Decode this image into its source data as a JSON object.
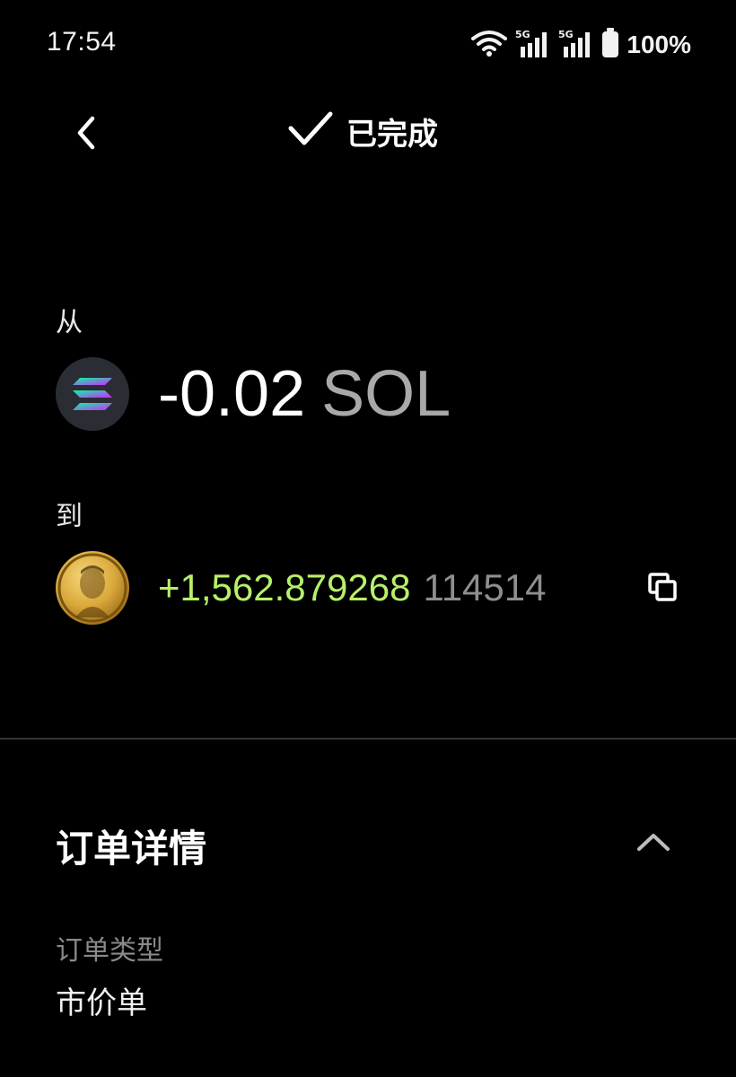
{
  "status_bar": {
    "time": "17:54",
    "battery": "100%",
    "icons": [
      "wifi-icon",
      "signal-5g-icon",
      "signal-5g-icon",
      "battery-icon"
    ]
  },
  "header": {
    "status_text": "已完成",
    "status_icon": "check-icon",
    "back_icon": "chevron-left-icon"
  },
  "transfer": {
    "from": {
      "label": "从",
      "amount": "-0.02",
      "symbol": "SOL",
      "icon": "solana-icon"
    },
    "to": {
      "label": "到",
      "amount": "+1,562.879268",
      "symbol": "114514",
      "icon": "token-coin-icon",
      "copy_icon": "copy-icon"
    }
  },
  "details": {
    "title": "订单详情",
    "collapse_icon": "chevron-up-icon",
    "fields": [
      {
        "label": "订单类型",
        "value": "市价单"
      }
    ]
  },
  "colors": {
    "background": "#000000",
    "positive": "#b7f06a",
    "muted": "#8a8a8a"
  }
}
